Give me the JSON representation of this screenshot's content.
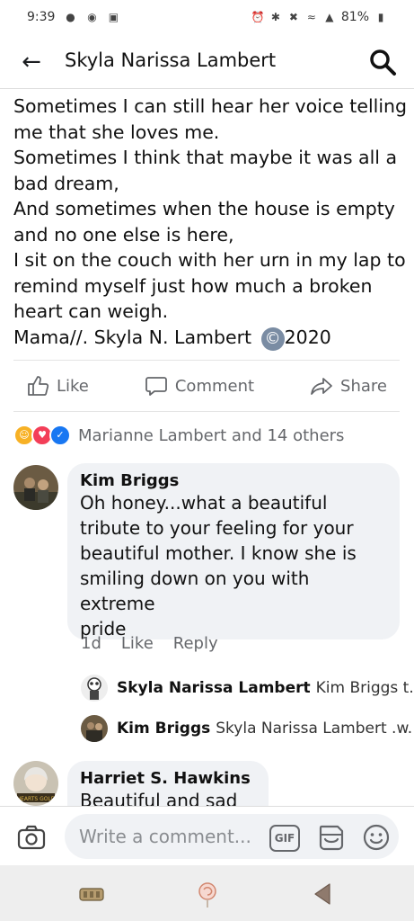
{
  "status_bar": {
    "time": "9:39",
    "battery": "81%",
    "left_icons": [
      "snapchat-icon",
      "app-icon",
      "gallery-icon"
    ],
    "right_icons": [
      "alarm-icon",
      "bluetooth-icon",
      "mute-icon",
      "wifi-icon",
      "signal-icon",
      "battery-icon"
    ]
  },
  "header": {
    "title": "Skyla Narissa Lambert"
  },
  "post": {
    "lines": [
      "Sometimes I can still hear her voice telling",
      "me that she loves me.",
      "Sometimes I think that maybe it was all a",
      "bad dream,",
      "And sometimes when the house is empty",
      "and no one else is here,",
      "I sit on the couch with her urn in my lap to",
      "remind myself just how much a broken",
      "heart can weigh.",
      "Mama//. Skyla N. Lambert",
      "2020"
    ],
    "copyright_symbol": "©"
  },
  "actions": {
    "like": "Like",
    "comment": "Comment",
    "share": "Share"
  },
  "reactions": {
    "summary": "Marianne Lambert and 14 others",
    "colors": {
      "care": "#f7b125",
      "love": "#f33e58",
      "like": "#1877f2"
    }
  },
  "comments": [
    {
      "author": "Kim Briggs",
      "lines": [
        "Oh honey...what a beautiful",
        "tribute to your feeling for your",
        "beautiful mother. I know she is",
        "smiling down on you with extreme",
        "pride"
      ],
      "time": "1d",
      "like": "Like",
      "reply": "Reply",
      "replies": [
        {
          "author": "Skyla Narissa Lambert",
          "text": "Kim Briggs t..."
        },
        {
          "author": "Kim Briggs",
          "text": "Skyla Narissa Lambert .w..."
        }
      ]
    },
    {
      "author": "Harriet S. Hawkins",
      "text": "Beautiful and sad",
      "avatar_text": "HEARTS GOLD"
    }
  ],
  "composer": {
    "placeholder": "Write a comment...",
    "gif": "GIF"
  },
  "colors": {
    "accent": "#1877f2",
    "muted": "#65676b",
    "bubble": "#f0f2f5"
  }
}
